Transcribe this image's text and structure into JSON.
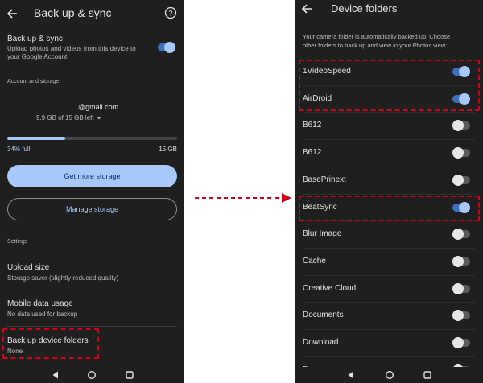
{
  "left": {
    "title": "Back up & sync",
    "sync": {
      "title": "Back up & sync",
      "desc_line1": "Upload photos and videos from this device to",
      "desc_line2": "your Google Account",
      "on": true
    },
    "account_header": "Account and storage",
    "account_email": "@gmail.com",
    "storage_left": "9.9 GB of 15 GB left",
    "storage_percent_label": "34% full",
    "storage_total": "15 GB",
    "storage_fraction": 0.34,
    "get_more_label": "Get more storage",
    "manage_label": "Manage storage",
    "settings_header": "Settings",
    "upload_size": {
      "title": "Upload size",
      "value": "Storage saver (slightly reduced quality)"
    },
    "mobile_data": {
      "title": "Mobile data usage",
      "value": "No data used for backup"
    },
    "device_folders": {
      "title": "Back up device folders",
      "value": "None"
    }
  },
  "right": {
    "title": "Device folders",
    "desc_line1": "Your camera folder is automatically backed up. Choose",
    "desc_line2": "other folders to back up and view in your Photos view:",
    "folders": [
      {
        "name": "1VideoSpeed",
        "on": true
      },
      {
        "name": "AirDroid",
        "on": true
      },
      {
        "name": "B612",
        "on": false
      },
      {
        "name": "B612",
        "on": false
      },
      {
        "name": "BasePrinext",
        "on": false
      },
      {
        "name": "BeatSync",
        "on": true
      },
      {
        "name": "Blur Image",
        "on": false
      },
      {
        "name": "Cache",
        "on": false
      },
      {
        "name": "Creative Cloud",
        "on": false
      },
      {
        "name": "Documents",
        "on": false
      },
      {
        "name": "Download",
        "on": false
      },
      {
        "name": "Duo",
        "on": false
      }
    ]
  },
  "colors": {
    "background": "#1f1f1f",
    "accent": "#a8c7fa",
    "highlight": "#d0021b"
  },
  "icons": [
    "back-arrow-icon",
    "help-icon",
    "chevron-down-icon",
    "back-triangle-icon",
    "home-circle-icon",
    "recents-square-icon",
    "dashed-arrow-icon"
  ]
}
